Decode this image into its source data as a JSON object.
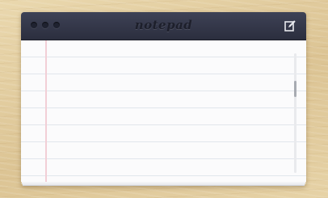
{
  "window": {
    "title": "notepad"
  },
  "titlebar": {
    "controls": [
      "close",
      "minimize",
      "zoom"
    ],
    "compose_icon": "edit-icon"
  },
  "editor": {
    "content": ""
  },
  "colors": {
    "titlebar": "#2f3242",
    "paper": "#fbfbfc",
    "rule_line": "#e1e6ec",
    "margin_line": "#f2cfd6",
    "desk": "#e3cfa3"
  }
}
